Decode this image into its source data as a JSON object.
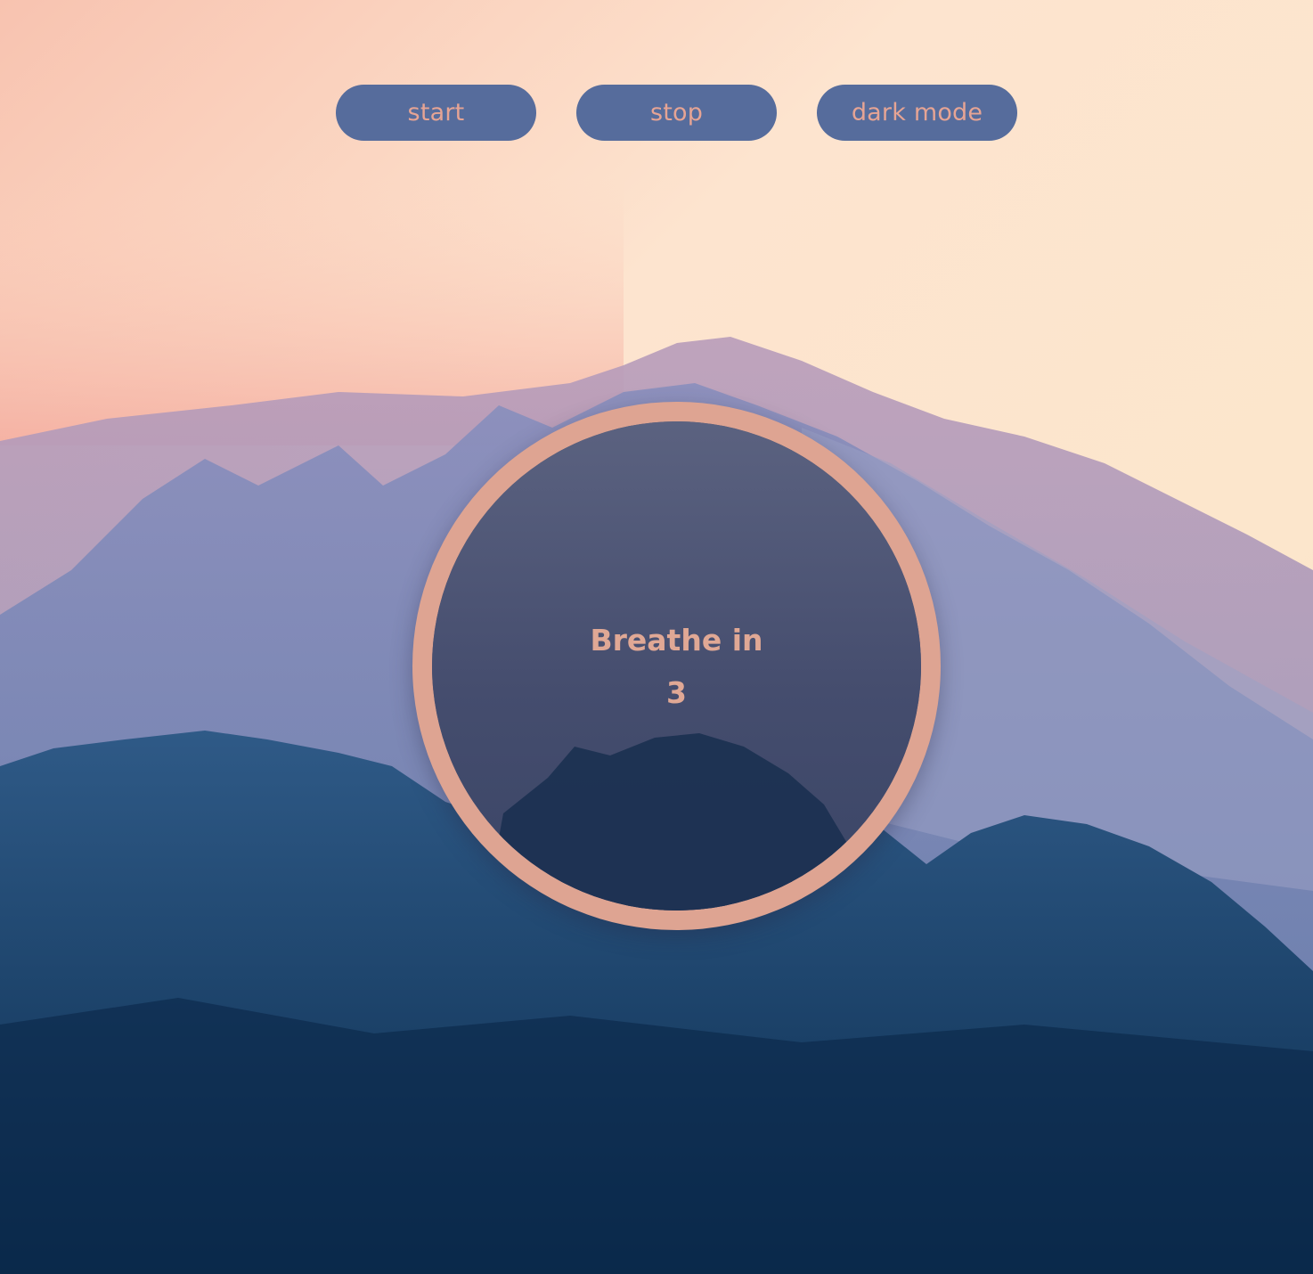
{
  "controls": {
    "start_label": "start",
    "stop_label": "stop",
    "dark_mode_label": "dark mode"
  },
  "breathing": {
    "phase": "Breathe in",
    "count": "3"
  },
  "colors": {
    "button_bg": "#566c9c",
    "button_text": "#e6a494",
    "ring": "#dea492",
    "circle_text": "#e0a895"
  }
}
